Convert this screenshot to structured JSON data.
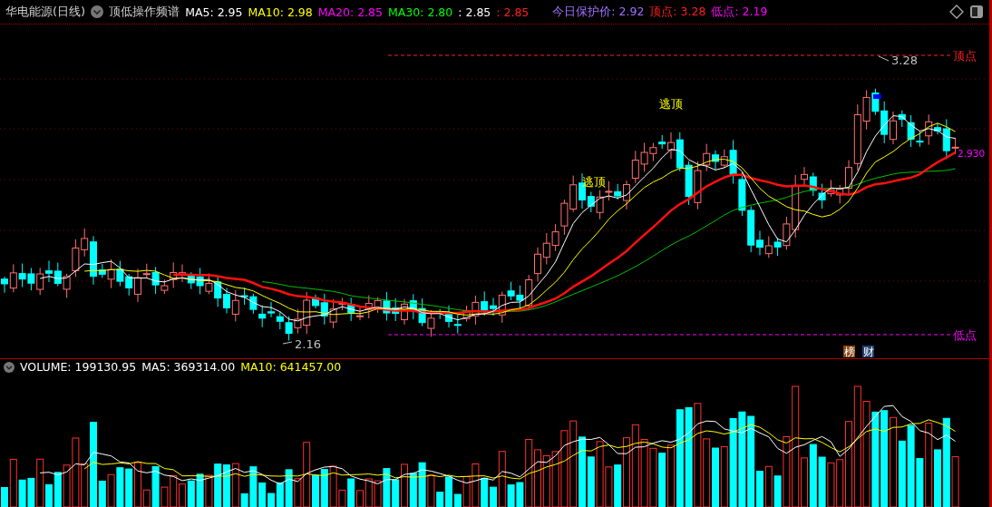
{
  "header": {
    "stock": "华电能源(日线)",
    "indicator_name": "顶低操作频谱",
    "ma_values": [
      {
        "text": "MA5: 2.95",
        "color": "#ffffff"
      },
      {
        "text": "MA10: 2.98",
        "color": "#ffff00"
      },
      {
        "text": "MA20: 2.85",
        "color": "#ff00ff"
      },
      {
        "text": "MA30: 2.80",
        "color": "#00ff00"
      },
      {
        "text": ": 2.85",
        "color": "#ffffff"
      },
      {
        "text": ": 2.85",
        "color": "#ff2020"
      },
      {
        "text": "今日保护价: 2.92",
        "color": "#a070ff"
      },
      {
        "text": "顶点: 3.28",
        "color": "#ff2020"
      },
      {
        "text": "低点: 2.19",
        "color": "#ff00ff"
      }
    ]
  },
  "price_chart": {
    "annotations": [
      {
        "text": "逃顶",
        "kind": "signal"
      },
      {
        "text": "逃顶",
        "kind": "signal"
      },
      {
        "text": "顶点",
        "kind": "top"
      },
      {
        "text": "低点",
        "kind": "bottom"
      },
      {
        "text": "3.28",
        "kind": "high"
      },
      {
        "text": "2.16",
        "kind": "low"
      },
      {
        "text": "2.930",
        "kind": "last"
      }
    ],
    "badges": [
      {
        "text": "榜",
        "color": "#8b4513"
      },
      {
        "text": "财",
        "color": "#1f3f6f"
      }
    ]
  },
  "volume_header": [
    {
      "text": "VOLUME: 199130.95",
      "color": "#ffffff"
    },
    {
      "text": "MA5: 369314.00",
      "color": "#ffffff"
    },
    {
      "text": "MA10: 641457.00",
      "color": "#ffff00"
    }
  ]
}
